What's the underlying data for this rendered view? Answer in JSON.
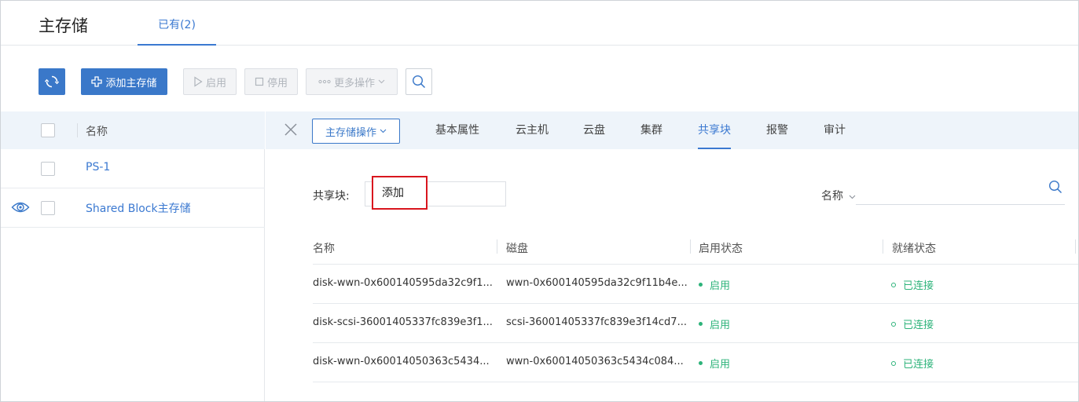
{
  "page": {
    "title": "主存储",
    "tab_existing": "已有(2)"
  },
  "toolbar": {
    "add_label": "添加主存储",
    "enable_label": "启用",
    "disable_label": "停用",
    "more_label": "更多操作"
  },
  "list": {
    "header": "名称",
    "rows": [
      {
        "name": "PS-1"
      },
      {
        "name": "Shared Block主存储"
      }
    ]
  },
  "detail": {
    "ops_label": "主存储操作",
    "tabs": [
      "基本属性",
      "云主机",
      "云盘",
      "集群",
      "共享块",
      "报警",
      "审计"
    ],
    "active_tab": "共享块",
    "shared_block_label": "共享块:",
    "add_label": "添加",
    "filter_label": "名称",
    "columns": [
      "名称",
      "磁盘",
      "启用状态",
      "就绪状态"
    ],
    "rows": [
      {
        "name": "disk-wwn-0x600140595da32c9f1...",
        "disk": "wwn-0x600140595da32c9f11b4e...",
        "enable": "启用",
        "ready": "已连接"
      },
      {
        "name": "disk-scsi-36001405337fc839e3f1...",
        "disk": "scsi-36001405337fc839e3f14cd7...",
        "enable": "启用",
        "ready": "已连接"
      },
      {
        "name": "disk-wwn-0x60014050363c5434...",
        "disk": "wwn-0x60014050363c5434c084...",
        "enable": "启用",
        "ready": "已连接"
      }
    ]
  },
  "colors": {
    "accent": "#3a78c9",
    "success": "#2db37a",
    "highlight": "#d9161e"
  },
  "icons": [
    "refresh-icon",
    "plus-icon",
    "play-icon",
    "stop-icon",
    "more-dots-icon",
    "search-icon",
    "eye-icon",
    "close-icon",
    "chevron-down-icon"
  ]
}
